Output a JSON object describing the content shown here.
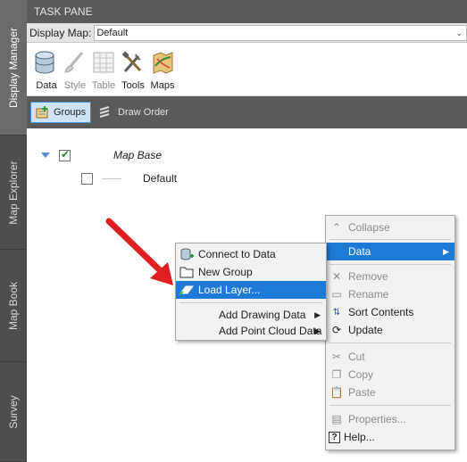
{
  "side_tabs": [
    "Display Manager",
    "Map Explorer",
    "Map Book",
    "Survey"
  ],
  "pane": {
    "title": "TASK PANE",
    "display_map_label": "Display Map:",
    "display_map_value": "Default"
  },
  "ribbon": {
    "buttons": [
      {
        "label": "Data",
        "icon": "database-icon"
      },
      {
        "label": "Style",
        "icon": "brush-icon"
      },
      {
        "label": "Table",
        "icon": "table-icon"
      },
      {
        "label": "Tools",
        "icon": "tools-icon"
      },
      {
        "label": "Maps",
        "icon": "map-icon"
      }
    ]
  },
  "toolbar": {
    "groups_label": "Groups",
    "draw_order_label": "Draw Order"
  },
  "tree": {
    "group_name": "Map Base",
    "layer_name": "Default"
  },
  "layer_menu": {
    "items": [
      {
        "label": "Collapse",
        "icon": "collapse-icon"
      },
      {
        "label": "Data",
        "icon": "none"
      },
      {
        "label": "Remove",
        "icon": "remove-icon"
      },
      {
        "label": "Rename",
        "icon": "rename-icon"
      },
      {
        "label": "Sort Contents",
        "icon": "sort-icon"
      },
      {
        "label": "Update",
        "icon": "update-icon"
      },
      {
        "label": "Cut",
        "icon": "cut-icon"
      },
      {
        "label": "Copy",
        "icon": "copy-icon"
      },
      {
        "label": "Paste",
        "icon": "paste-icon"
      },
      {
        "label": "Properties...",
        "icon": "properties-icon"
      },
      {
        "label": "Help...",
        "icon": "help-icon"
      }
    ]
  },
  "data_submenu": {
    "items": [
      {
        "label": "Connect to Data",
        "icon": "connect-data-icon"
      },
      {
        "label": "New Group",
        "icon": "folder-icon"
      },
      {
        "label": "Load Layer...",
        "icon": "load-layer-icon"
      },
      {
        "label": "Add Drawing Data",
        "icon": "none"
      },
      {
        "label": "Add Point Cloud Data",
        "icon": "none"
      }
    ]
  },
  "colors": {
    "highlight": "#1f7ad6",
    "pane_header": "#5a5a5a",
    "arrow": "#e02020"
  }
}
